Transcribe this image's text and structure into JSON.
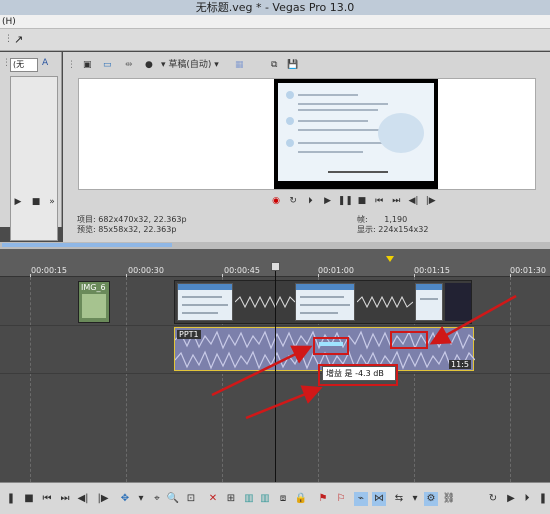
{
  "window": {
    "title": "无标题.veg * - Vegas Pro 13.0"
  },
  "menubar": {
    "text": "(H)"
  },
  "left_panel": {
    "dropdown": "(无",
    "buttons": [
      "▶",
      "■",
      "»"
    ]
  },
  "preview": {
    "toolbar": {
      "quality": "草稿(自动)"
    },
    "info": {
      "project_label": "项目:",
      "project_value": "682x470x32, 22.363p",
      "preview_label": "预览:",
      "preview_value": "85x58x32, 22.363p",
      "frame_label": "帧:",
      "frame_value": "1,190",
      "display_label": "显示:",
      "display_value": "224x154x32"
    }
  },
  "ruler": {
    "labels": [
      "00:00:15",
      "00:00:30",
      "00:00:45",
      "00:01:00",
      "00:01:15",
      "00:01:30"
    ]
  },
  "tracks": {
    "image_clip": {
      "label": "IMG_6"
    },
    "audio_clip": {
      "label": "PPT1",
      "end_label": "11:5"
    },
    "tooltip": "增益 是 -4.3 dB"
  },
  "colors": {
    "annotation": "#d01818",
    "audio_border": "#e2c53a",
    "selection_blue": "#8fb7e6"
  }
}
